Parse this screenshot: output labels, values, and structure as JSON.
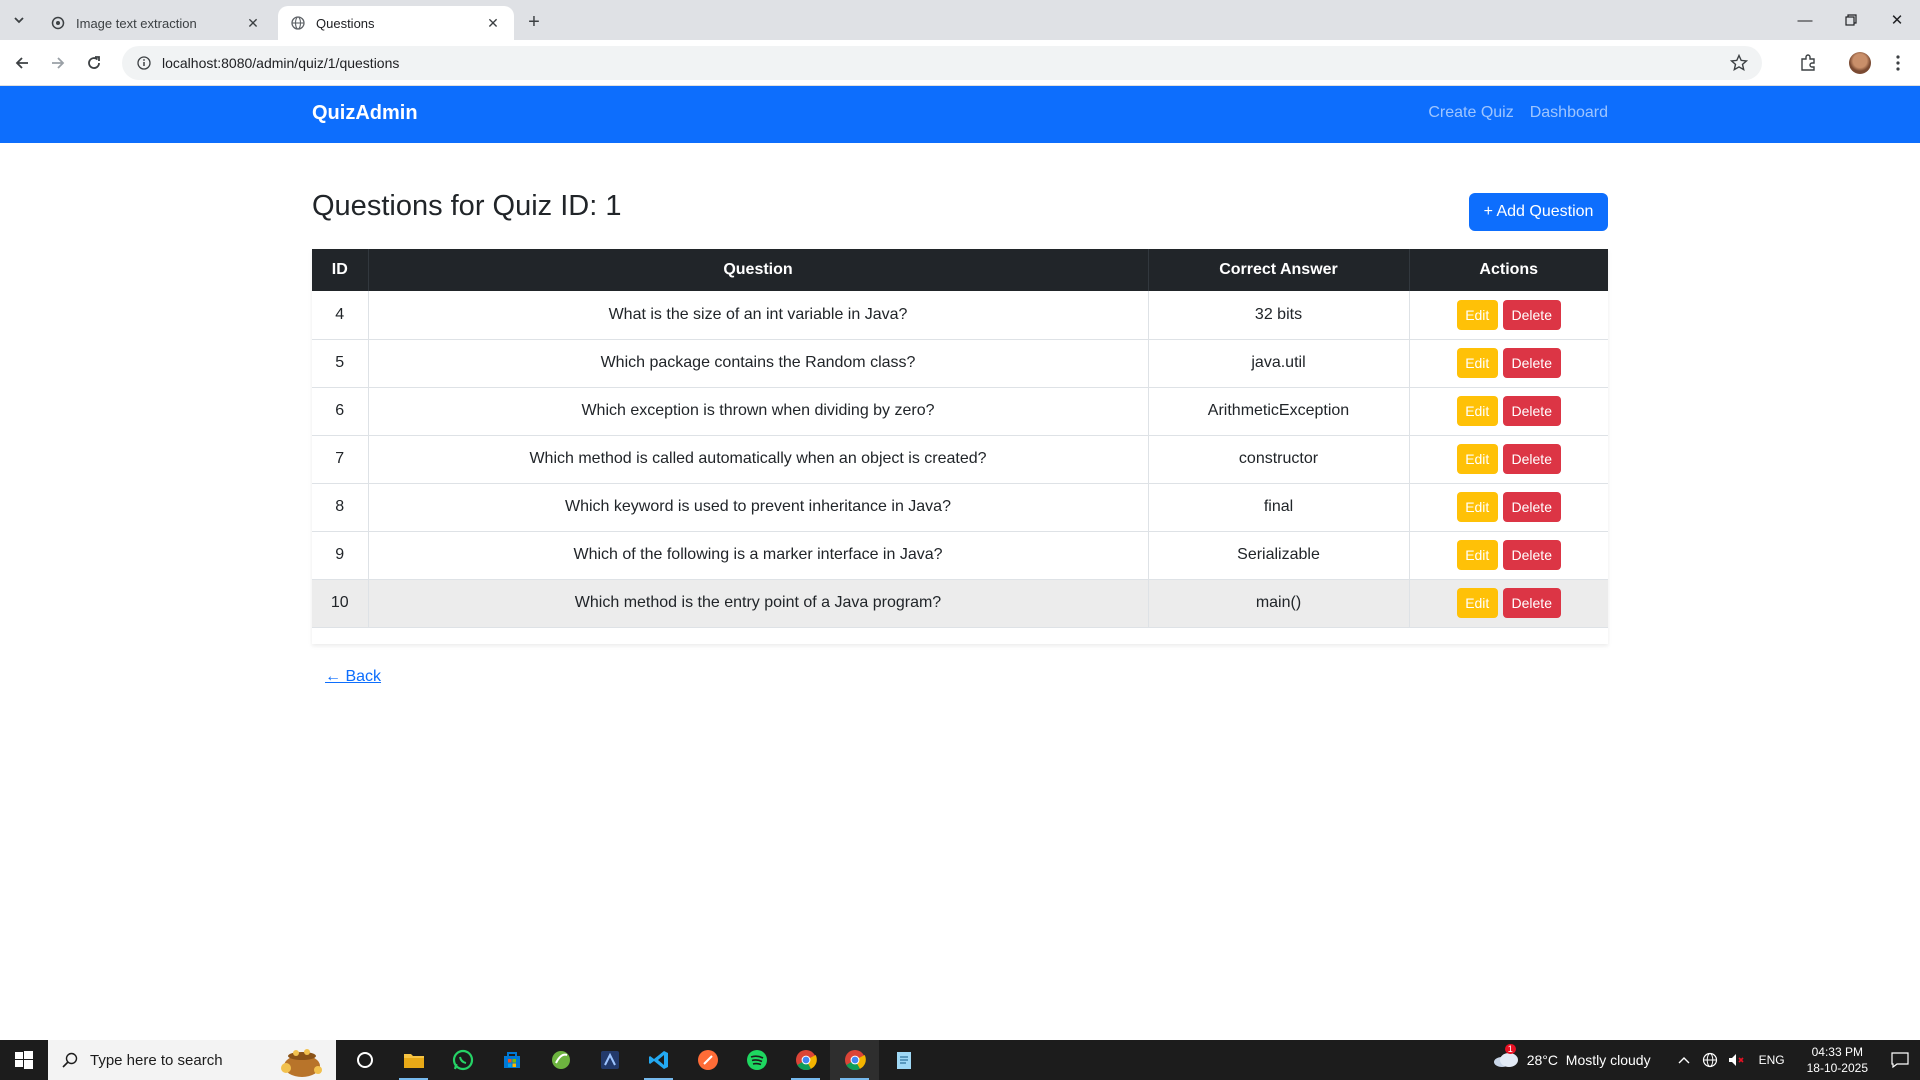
{
  "browser": {
    "tabs": [
      {
        "title": "Image text extraction",
        "active": false
      },
      {
        "title": "Questions",
        "active": true
      }
    ],
    "url": "localhost:8080/admin/quiz/1/questions"
  },
  "navbar": {
    "brand": "QuizAdmin",
    "links": [
      "Create Quiz",
      "Dashboard"
    ]
  },
  "page": {
    "title": "Questions for Quiz ID: 1",
    "add_button": "+ Add Question",
    "back_link": "← Back"
  },
  "table": {
    "headers": [
      "ID",
      "Question",
      "Correct Answer",
      "Actions"
    ],
    "edit_label": "Edit",
    "delete_label": "Delete",
    "rows": [
      {
        "id": "4",
        "question": "What is the size of an int variable in Java?",
        "answer": "32 bits"
      },
      {
        "id": "5",
        "question": "Which package contains the Random class?",
        "answer": "java.util"
      },
      {
        "id": "6",
        "question": "Which exception is thrown when dividing by zero?",
        "answer": "ArithmeticException"
      },
      {
        "id": "7",
        "question": "Which method is called automatically when an object is created?",
        "answer": "constructor"
      },
      {
        "id": "8",
        "question": "Which keyword is used to prevent inheritance in Java?",
        "answer": "final"
      },
      {
        "id": "9",
        "question": "Which of the following is a marker interface in Java?",
        "answer": "Serializable"
      },
      {
        "id": "10",
        "question": "Which method is the entry point of a Java program?",
        "answer": "main()"
      }
    ]
  },
  "taskbar": {
    "search_placeholder": "Type here to search",
    "weather": "28°C  Mostly cloudy",
    "weather_badge": "1",
    "language": "ENG",
    "time": "04:33 PM",
    "date": "18-10-2025"
  },
  "colors": {
    "primary": "#0d6efd",
    "warning": "#ffc107",
    "danger": "#dc3545",
    "table_header": "#212529"
  }
}
